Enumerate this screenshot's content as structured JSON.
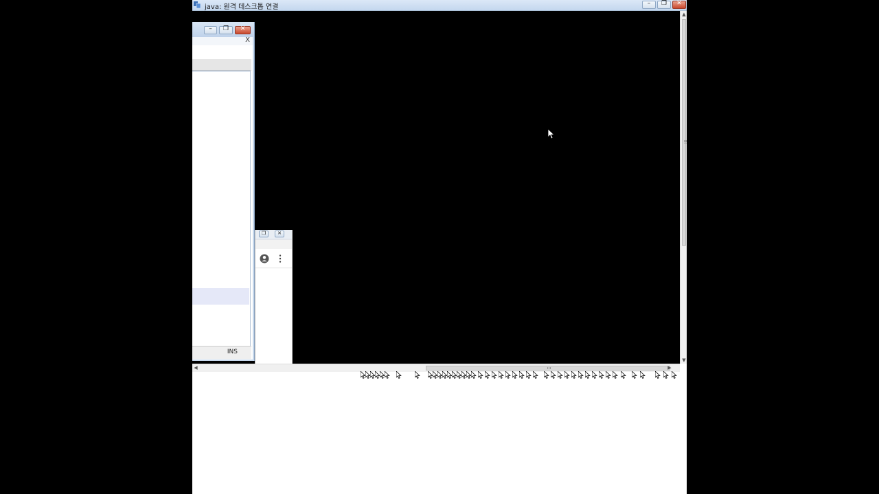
{
  "window": {
    "title": "java: 원격 데스크톱 연결",
    "minimize_glyph": "–",
    "restore_glyph": "❐",
    "close_glyph": "✕"
  },
  "dialog": {
    "header_close": "X",
    "status_mode": "INS"
  },
  "icons": {
    "app": "remote-desktop-icon",
    "account": "account-circle-icon",
    "menu": "more-vert-icon",
    "pointer": "mouse-pointer-icon"
  },
  "colors": {
    "titlebar": "#c4d7ee",
    "close_button": "#c9482c",
    "remote_background": "#000000",
    "selected_row": "#e5e8f8"
  }
}
